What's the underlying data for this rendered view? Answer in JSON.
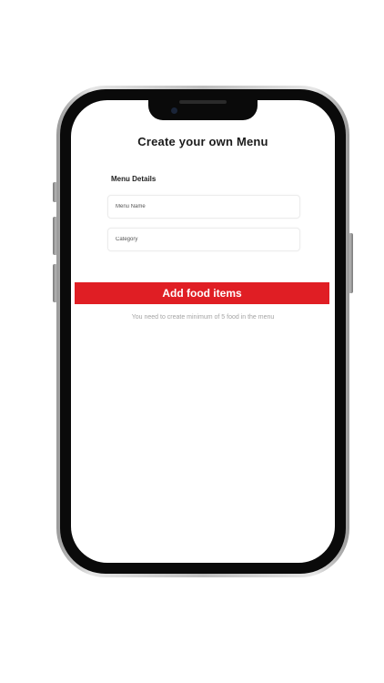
{
  "screen": {
    "title": "Create your own Menu",
    "section_label": "Menu Details",
    "fields": {
      "menu_name": {
        "value": "",
        "placeholder": "Menu Name"
      },
      "category": {
        "value": "",
        "placeholder": "Category"
      }
    },
    "add_button_label": "Add food items",
    "helper_text": "You need to create minimum of 5 food in the menu"
  },
  "colors": {
    "accent": "#e01e24",
    "title_text": "#1b1b1b",
    "helper_text": "#a3a3a3",
    "phone_bezel": "#0a0a0a"
  }
}
